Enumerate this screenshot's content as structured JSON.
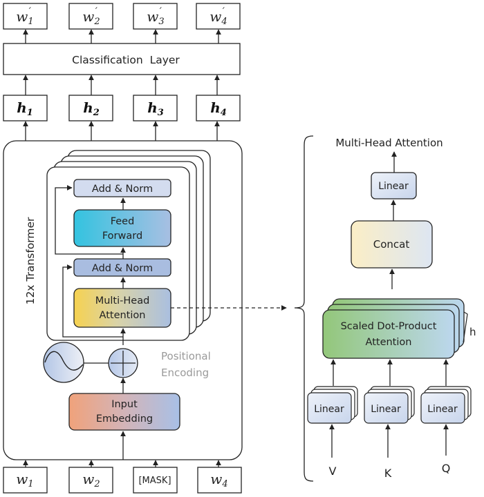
{
  "outputs": [
    {
      "base": "w",
      "sub": "1",
      "prime": "′"
    },
    {
      "base": "w",
      "sub": "2",
      "prime": "′"
    },
    {
      "base": "w",
      "sub": "3",
      "prime": "′"
    },
    {
      "base": "w",
      "sub": "4",
      "prime": "′"
    }
  ],
  "classification_layer": "Classification  Layer",
  "hidden": [
    {
      "base": "h",
      "sub": "1"
    },
    {
      "base": "h",
      "sub": "2"
    },
    {
      "base": "h",
      "sub": "3"
    },
    {
      "base": "h",
      "sub": "4"
    }
  ],
  "transformer": {
    "label": "12x Transformer",
    "add_norm_top": "Add & Norm",
    "feed_forward": [
      "Feed",
      "Forward"
    ],
    "add_norm_bottom": "Add & Norm",
    "multi_head": [
      "Multi-Head",
      "Attention"
    ],
    "positional_encoding": [
      "Positional",
      "Encoding"
    ],
    "input_embedding": [
      "Input",
      "Embedding"
    ]
  },
  "inputs": [
    {
      "base": "w",
      "sub": "1",
      "text": ""
    },
    {
      "base": "w",
      "sub": "2",
      "text": ""
    },
    {
      "base": "",
      "sub": "",
      "text": "[MASK]"
    },
    {
      "base": "w",
      "sub": "4",
      "text": ""
    }
  ],
  "mha_detail": {
    "title": "Multi-Head Attention",
    "linear_out": "Linear",
    "concat": "Concat",
    "sdpa": [
      "Scaled Dot-Product",
      "Attention"
    ],
    "heads_label": "h",
    "linears": [
      "Linear",
      "Linear",
      "Linear"
    ],
    "qkv": [
      "V",
      "K",
      "Q"
    ]
  },
  "colors": {
    "stroke": "#222222",
    "add_norm_top": "#d3dcef",
    "add_norm_bottom": "#a9bde0",
    "feed_forward_start": "#33c3e0",
    "feed_forward_end": "#a8bfe2",
    "mha_start": "#f6d250",
    "mha_end": "#aabfe0",
    "embed_start": "#f0a27b",
    "embed_end": "#a8c0e6",
    "pos_enc_text": "#9a9a9a",
    "concat_start": "#fbeec6",
    "concat_end": "#dde6f2",
    "sdpa_start": "#93c77a",
    "sdpa_end": "#bcd7ee",
    "linear_fill": "#dbe4f3"
  }
}
